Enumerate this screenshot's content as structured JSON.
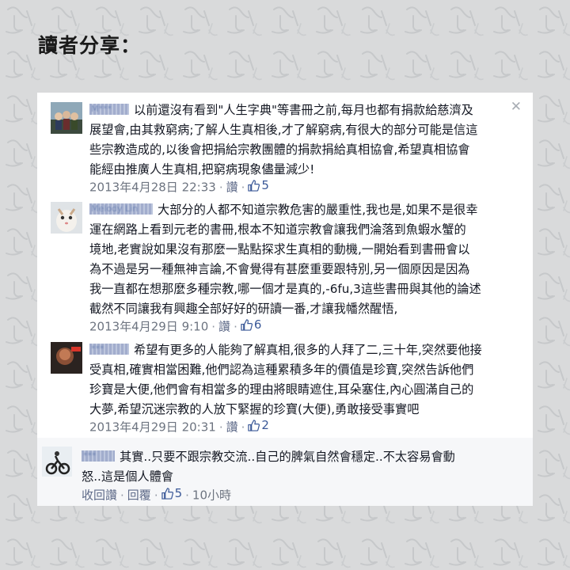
{
  "page_title": "讀者分享：",
  "close_icon": "close-icon",
  "comments": [
    {
      "username": "M***",
      "text_lines": [
        "以前還沒有看到\"人生字典\"等書冊之前,每月也都有捐款給慈濟及",
        "展望會,由其救窮病;了解人生真相後,才了解窮病,有很大的部分可能是信這",
        "些宗教造成的,以後會把捐給宗教團體的捐款捐給真相協會,希望真相協會",
        "能經由推廣人生真相,把窮病現象儘量減少!"
      ],
      "timestamp": "2013年4月28日 22:33",
      "like_label": "讚",
      "like_count": "5"
    },
    {
      "username": "Melody Lin",
      "text_lines": [
        "大部分的人都不知道宗教危害的嚴重性,我也是,如果不是很幸",
        "運在網路上看到元老的書冊,根本不知道宗教會讓我們淪落到魚蝦水蟹的",
        "境地,老實說如果沒有那麼一點點探求生真相的動機,一開始看到書冊會以",
        "為不過是另一種無神言論,不會覺得有甚麼重要跟特別,另一個原因是因為",
        "我一直都在想那麼多種宗教,哪一個才是真的,-6fu,3這些書冊與其他的論述",
        "截然不同讓我有興趣全部好好的研讀一番,才讓我幡然醒悟,"
      ],
      "timestamp": "2013年4月29日 9:10",
      "like_label": "讚",
      "like_count": "6"
    },
    {
      "username": "***",
      "text_lines": [
        "希望有更多的人能夠了解真相,很多的人拜了二,三十年,突然要他接",
        "受真相,確實相當困難,他們認為這種累積多年的價值是珍寶,突然告訴他們",
        "珍寶是大便,他們會有相當多的理由將眼睛遮住,耳朵塞住,內心圓滿自己的",
        "大夢,希望沉迷宗教的人放下緊握的珍寶(大便),勇敢接受事實吧"
      ],
      "timestamp": "2013年4月29日 20:31",
      "like_label": "讚",
      "like_count": "2"
    }
  ],
  "reply": {
    "username": "***",
    "text_lines": [
      "其實..只要不跟宗教交流..自己的脾氣自然會穩定..不太容易會動",
      "怒..這是個人體會"
    ],
    "withdraw_label": "收回讚",
    "reply_label": "回覆",
    "like_count": "5",
    "time_ago": "10小時"
  },
  "colors": {
    "background": "#d9dadb",
    "panel": "#ffffff",
    "link": "#3b5998",
    "meta": "#6d7480"
  }
}
